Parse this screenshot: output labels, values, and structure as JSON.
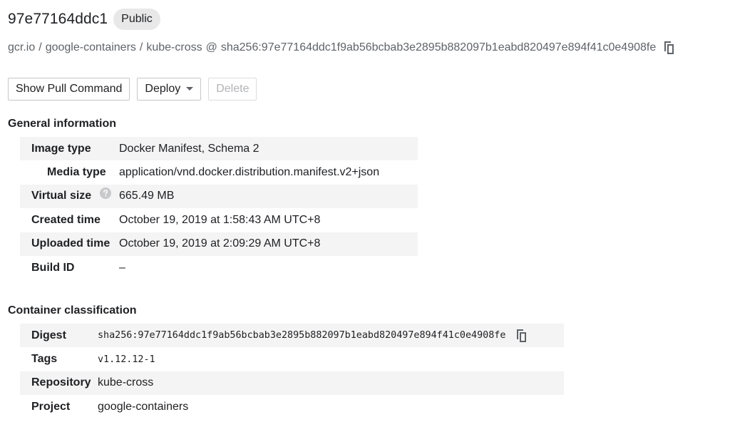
{
  "header": {
    "title": "97e77164ddc1",
    "visibility_badge": "Public"
  },
  "breadcrumb": {
    "registry": "gcr.io",
    "separator": "/",
    "project": "google-containers",
    "repository": "kube-cross",
    "at": "@",
    "digest": "sha256:97e77164ddc1f9ab56bcbab3e2895b882097b1eabd820497e894f41c0e4908fe",
    "copy_icon": "copy-icon"
  },
  "toolbar": {
    "show_pull_label": "Show Pull Command",
    "deploy_label": "Deploy",
    "delete_label": "Delete"
  },
  "general": {
    "title": "General information",
    "rows": [
      {
        "key": "Image type",
        "value": "Docker Manifest, Schema 2"
      },
      {
        "key": "Media type",
        "value": "application/vnd.docker.distribution.manifest.v2+json"
      },
      {
        "key": "Virtual size",
        "value": "665.49 MB",
        "help_icon": "help-icon"
      },
      {
        "key": "Created time",
        "value": "October 19, 2019 at 1:58:43 AM UTC+8"
      },
      {
        "key": "Uploaded time",
        "value": "October 19, 2019 at 2:09:29 AM UTC+8"
      },
      {
        "key": "Build ID",
        "value": "–"
      }
    ]
  },
  "classification": {
    "title": "Container classification",
    "rows": [
      {
        "key": "Digest",
        "value": "sha256:97e77164ddc1f9ab56bcbab3e2895b882097b1eabd820497e894f41c0e4908fe"
      },
      {
        "key": "Tags",
        "value": "v1.12.12-1"
      },
      {
        "key": "Repository",
        "value": "kube-cross"
      },
      {
        "key": "Project",
        "value": "google-containers"
      }
    ]
  },
  "colors": {
    "text": "#202124",
    "muted": "#5f6368",
    "row_shade": "#f4f4f4",
    "badge_bg": "#e8e8e8",
    "disabled": "#b1b3b6"
  }
}
